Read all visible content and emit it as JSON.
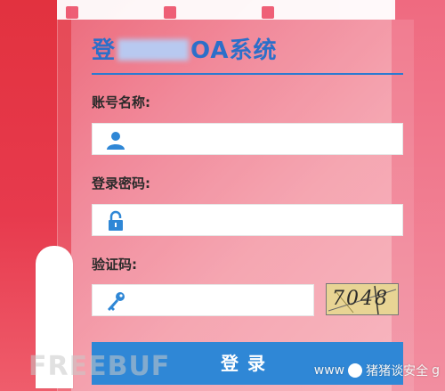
{
  "login": {
    "title_prefix": "登",
    "title_suffix": "OA系统",
    "username_label": "账号名称:",
    "username_value": "",
    "password_label": "登录密码:",
    "password_value": "",
    "captcha_label": "验证码:",
    "captcha_value": "",
    "captcha_text": "7048",
    "submit_label": "登录"
  },
  "watermarks": {
    "left": "FREEBUF",
    "right_url": "www",
    "right_name": "猪猪谈安全",
    "right_suffix": "g"
  },
  "colors": {
    "accent_blue": "#2c6fc9",
    "button_blue": "#2f87d6",
    "background_pink": "#f07c8f"
  },
  "icons": {
    "username": "user-icon",
    "password": "lock-icon",
    "captcha": "key-icon"
  }
}
